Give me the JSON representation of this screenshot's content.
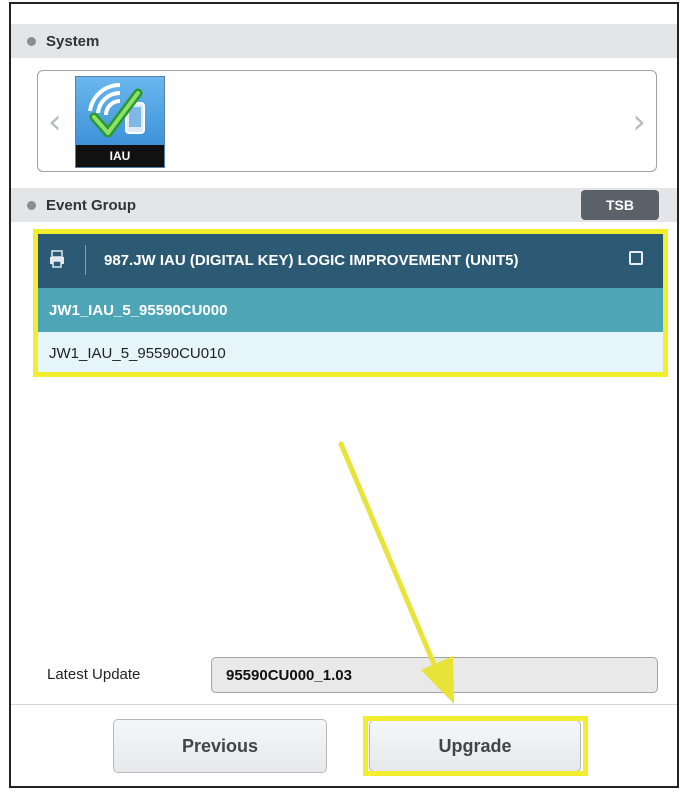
{
  "system": {
    "header_label": "System",
    "tile_label": "IAU",
    "icon": "iau-check-phone-icon",
    "nav_left": "‹",
    "nav_right": "›"
  },
  "event_group": {
    "header_label": "Event Group",
    "tsb_label": "TSB",
    "list_title": "987.JW IAU (DIGITAL KEY) LOGIC IMPROVEMENT (UNIT5)",
    "items": [
      {
        "label": "JW1_IAU_5_95590CU000",
        "selected": true
      },
      {
        "label": "JW1_IAU_5_95590CU010",
        "selected": false
      }
    ]
  },
  "latest_update": {
    "label": "Latest Update",
    "value": "95590CU000_1.03"
  },
  "buttons": {
    "previous": "Previous",
    "upgrade": "Upgrade"
  },
  "colors": {
    "header_bg": "#e3e5e8",
    "list_title_bg": "#2c5a75",
    "selected_row_bg": "#4ea5b5",
    "row_bg": "#e6f5fa",
    "highlight": "#f3ee2d"
  }
}
